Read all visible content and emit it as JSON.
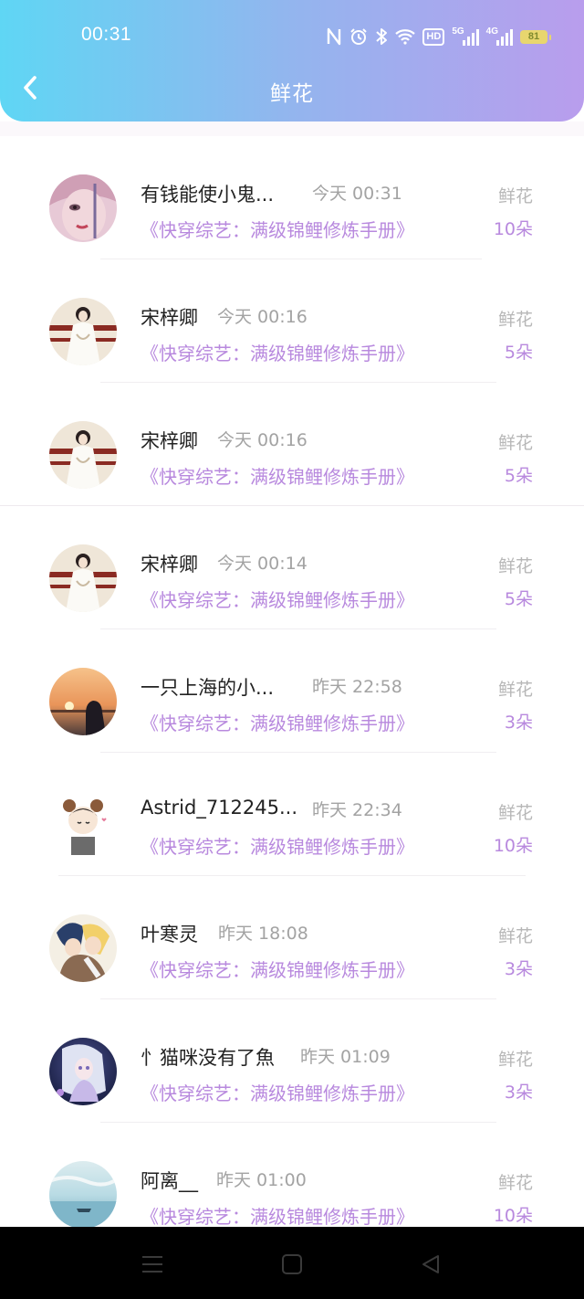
{
  "status_bar": {
    "time": "00:31",
    "network_labels": [
      "5G",
      "4G"
    ],
    "hd_badge": "HD",
    "battery": "81"
  },
  "header": {
    "title": "鲜花"
  },
  "list": [
    {
      "name": "有钱能使小鬼...",
      "time": "今天 00:31",
      "book": "《快穿综艺：满级锦鲤修炼手册》",
      "gift_label": "鲜花",
      "gift_count": "10朵"
    },
    {
      "name": "宋梓卿",
      "time": "今天 00:16",
      "book": "《快穿综艺：满级锦鲤修炼手册》",
      "gift_label": "鲜花",
      "gift_count": "5朵"
    },
    {
      "name": "宋梓卿",
      "time": "今天 00:16",
      "book": "《快穿综艺：满级锦鲤修炼手册》",
      "gift_label": "鲜花",
      "gift_count": "5朵"
    },
    {
      "name": "宋梓卿",
      "time": "今天 00:14",
      "book": "《快穿综艺：满级锦鲤修炼手册》",
      "gift_label": "鲜花",
      "gift_count": "5朵"
    },
    {
      "name": "一只上海的小...",
      "time": "昨天 22:58",
      "book": "《快穿综艺：满级锦鲤修炼手册》",
      "gift_label": "鲜花",
      "gift_count": "3朵"
    },
    {
      "name": "Astrid_712245...",
      "time": "昨天 22:34",
      "book": "《快穿综艺：满级锦鲤修炼手册》",
      "gift_label": "鲜花",
      "gift_count": "10朵"
    },
    {
      "name": "叶寒灵",
      "time": "昨天 18:08",
      "book": "《快穿综艺：满级锦鲤修炼手册》",
      "gift_label": "鲜花",
      "gift_count": "3朵"
    },
    {
      "name": "忄猫咪没有了魚",
      "time": "昨天 01:09",
      "book": "《快穿综艺：满级锦鲤修炼手册》",
      "gift_label": "鲜花",
      "gift_count": "3朵"
    },
    {
      "name": "阿离__",
      "time": "昨天 01:00",
      "book": "《快穿综艺：满级锦鲤修炼手册》",
      "gift_label": "鲜花",
      "gift_count": "10朵"
    }
  ],
  "colors": {
    "accent": "#b889de",
    "header_start": "#5fd6f4",
    "header_end": "#b99ded"
  }
}
